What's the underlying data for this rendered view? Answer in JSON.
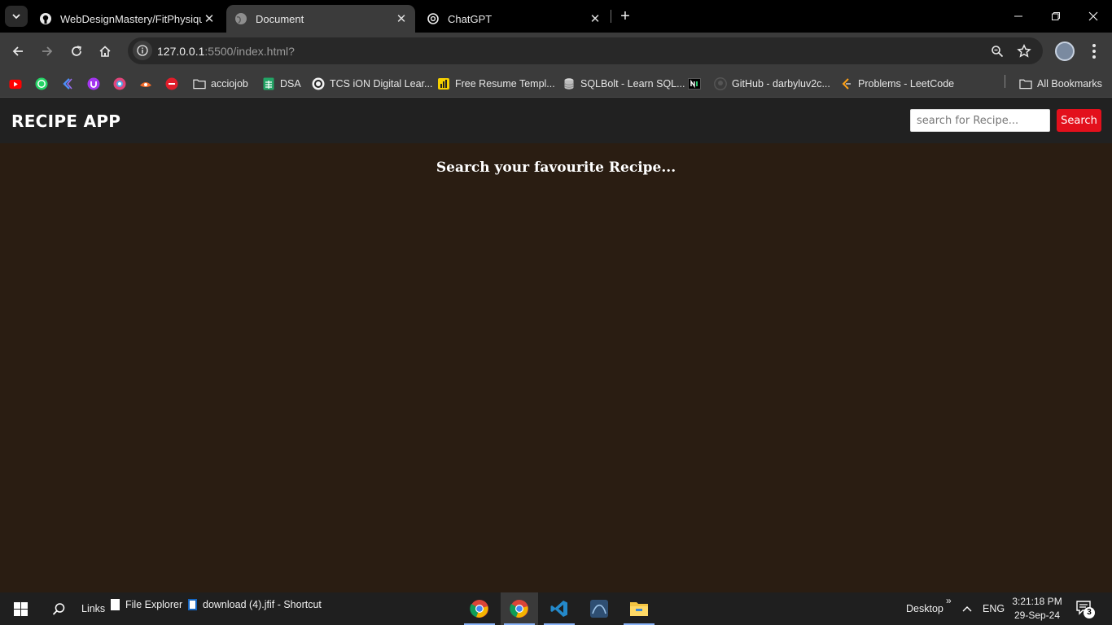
{
  "browser": {
    "tabs": [
      {
        "title": "WebDesignMastery/FitPhysique",
        "icon": "github-icon",
        "active": false
      },
      {
        "title": "Document",
        "icon": "globe-icon",
        "active": true
      },
      {
        "title": "ChatGPT",
        "icon": "chatgpt-icon",
        "active": false
      }
    ],
    "address": {
      "host": "127.0.0.1",
      "rest": ":5500/index.html?"
    },
    "bookmarks": [
      {
        "label": "",
        "icon": "youtube-icon",
        "color": "#ff0000"
      },
      {
        "label": "",
        "icon": "whatsapp-icon",
        "color": "#25d366"
      },
      {
        "label": "",
        "icon": "kotlin-icon",
        "color": "#4d8df7"
      },
      {
        "label": "",
        "icon": "udemy-icon",
        "color": "#a435f0"
      },
      {
        "label": "",
        "icon": "site-icon",
        "color": "#e0457b"
      },
      {
        "label": "",
        "icon": "site-icon",
        "color": "#f26b2a"
      },
      {
        "label": "",
        "icon": "tuf-icon",
        "color": "#e11d2a"
      },
      {
        "label": "acciojob",
        "icon": "folder-icon"
      },
      {
        "label": "DSA",
        "icon": "sheets-icon",
        "color": "#23a566"
      },
      {
        "label": "TCS iON Digital Lear...",
        "icon": "tcs-icon"
      },
      {
        "label": "Free Resume Templ...",
        "icon": "resume-icon",
        "color": "#f5d000"
      },
      {
        "label": "SQLBolt - Learn SQL...",
        "icon": "database-icon"
      },
      {
        "label": "",
        "icon": "n-icon"
      },
      {
        "label": "GitHub - darbyluv2c...",
        "icon": "github-icon"
      },
      {
        "label": "Problems - LeetCode",
        "icon": "leetcode-icon",
        "color": "#ffa116"
      }
    ],
    "all_bookmarks": "All Bookmarks"
  },
  "app": {
    "logo": "RECIPE APP",
    "search_placeholder": "search for Recipe...",
    "search_button": "Search",
    "welcome": "Search your favourite Recipe...",
    "accent_color": "#e3101c",
    "background_color": "#2a1d12"
  },
  "taskbar": {
    "links": "Links",
    "file_explorer": "File Explorer",
    "shortcut": "download (4).jfif - Shortcut",
    "desktop": "Desktop",
    "lang": "ENG",
    "time": "3:21:18 PM",
    "date": "29-Sep-24",
    "notifications": "3"
  }
}
